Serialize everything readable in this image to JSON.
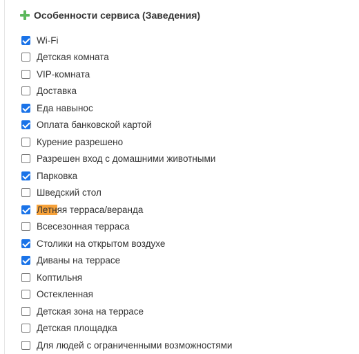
{
  "header": {
    "title": "Особенности сервиса (Заведения)",
    "icon": "plus-icon",
    "icon_color": "#5cb85c"
  },
  "items": [
    {
      "label": "Wi-Fi",
      "checked": true
    },
    {
      "label": "Детская комната",
      "checked": false
    },
    {
      "label": "VIP-комната",
      "checked": false
    },
    {
      "label": "Доставка",
      "checked": false
    },
    {
      "label": "Еда навынос",
      "checked": true
    },
    {
      "label": "Оплата банковской картой",
      "checked": true
    },
    {
      "label": "Курение разрешено",
      "checked": false
    },
    {
      "label": "Разрешен вход с домашними животными",
      "checked": false
    },
    {
      "label": "Парковка",
      "checked": true
    },
    {
      "label": "Шведский стол",
      "checked": false
    },
    {
      "label": "Летняя терраса/веранда",
      "checked": true,
      "highlight": "Летн"
    },
    {
      "label": "Всесезонная терраса",
      "checked": false
    },
    {
      "label": "Столики на открытом воздухе",
      "checked": true
    },
    {
      "label": "Диваны на террасе",
      "checked": true
    },
    {
      "label": "Коптильня",
      "checked": false
    },
    {
      "label": "Остекленная",
      "checked": false
    },
    {
      "label": "Детская зона на террасе",
      "checked": false
    },
    {
      "label": "Детская площадка",
      "checked": false
    },
    {
      "label": "Для людей с ограниченными возможностями",
      "checked": false
    }
  ],
  "colors": {
    "checkbox_checked": "#1a73e8",
    "highlight": "#f7a23a"
  }
}
